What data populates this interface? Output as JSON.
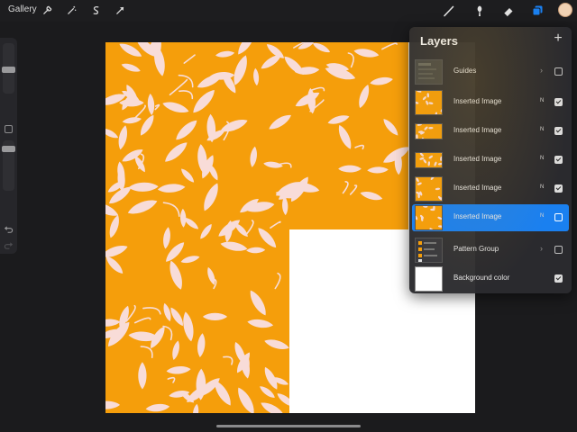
{
  "toolbar": {
    "gallery_label": "Gallery",
    "left_icons": [
      "wrench-icon",
      "magic-wand-icon",
      "selection-icon",
      "transform-arrow-icon"
    ],
    "right_icons": [
      "brush-icon",
      "smudge-icon",
      "eraser-icon",
      "layers-icon",
      "color-swatch"
    ],
    "accent": "#1a80f0",
    "current_color": "#f0d2b4"
  },
  "sidebar": {
    "controls": [
      "brush-size-slider",
      "modify-button",
      "opacity-slider",
      "undo-icon",
      "redo-icon"
    ]
  },
  "canvas": {
    "pattern_background": "#f59e0b",
    "leaf_color": "#f8dcd8",
    "paper_color": "#ffffff"
  },
  "layers_panel": {
    "title": "Layers",
    "add_label": "+",
    "layers": [
      {
        "name": "Guides",
        "type": "group",
        "visible": false
      },
      {
        "name": "Inserted Image",
        "blend": "N",
        "visible": true,
        "selected": false
      },
      {
        "name": "Inserted Image",
        "blend": "N",
        "visible": true,
        "selected": false
      },
      {
        "name": "Inserted Image",
        "blend": "N",
        "visible": true,
        "selected": false
      },
      {
        "name": "Inserted Image",
        "blend": "N",
        "visible": true,
        "selected": false
      },
      {
        "name": "Inserted Image",
        "blend": "N",
        "visible": false,
        "selected": true
      },
      {
        "name": "Pattern Group",
        "type": "group",
        "visible": false
      },
      {
        "name": "Background color",
        "visible": true
      }
    ]
  }
}
